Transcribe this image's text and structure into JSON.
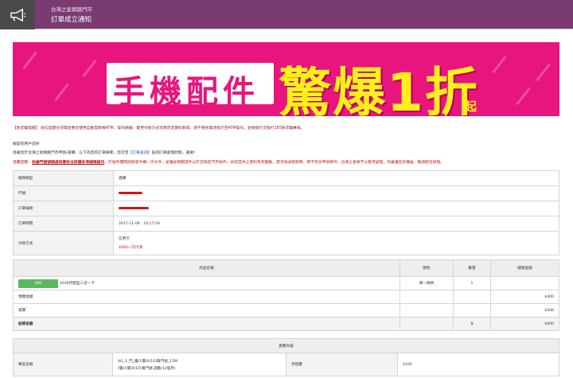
{
  "header": {
    "title": "台灣之星網路門市",
    "subtitle": "訂單成立通知",
    "logo_icon": "megaphone-icon"
  },
  "banner": {
    "prefix": "手機配件",
    "headline": "驚爆1折",
    "suffix": "起"
  },
  "notice": "【防詐騙提醒】 收信提醒任何電話要您使用自動提款機ATM，操作網銀，變更付款方式或更改定期扣款等，請不要依電話指示至ATM操作，並撥撥打可撥打165防詐騙專線。",
  "greeting": "親愛的用戶您好",
  "thanks_prefix": "感謝您於台灣之星網路門市申辦/選購，以下為您的訂單摘要，您可至",
  "thanks_link": "【訂單查詢】",
  "thanks_suffix": "查詢訂單處理狀態，謝謝！",
  "warning_prefix": "溫馨提醒：",
  "warning_bold": "依據門號號碼通訊應依法保護各項號碼操作",
  "warning_rest": "，於送件期間請留意手機一次文件，並攜妥相關證件以於您指定門市收件，依您提供之資料有所變動，需求後收取款時，即不符合申辦要件，台灣之星將予以暫停處理，為維護您的權益，敬請配合辦理。",
  "order": {
    "rows": [
      {
        "key": "服務類型",
        "value": "選購"
      },
      {
        "key": "門號",
        "value": ""
      },
      {
        "key": "訂單編號",
        "value": ""
      },
      {
        "key": "訂單時間",
        "value": "2017-11-09　20:17:54"
      }
    ],
    "payment_key": "付款方式",
    "payment_value": "信用卡",
    "payment_note": "$000一次付清"
  },
  "products": {
    "headers": [
      "商品名稱",
      "顏色",
      "數量",
      "總帳金額"
    ],
    "items": [
      {
        "badge": "SIM",
        "name": "2018月租型三合一卡",
        "color": "單一規格",
        "qty": "1",
        "amount": ""
      }
    ],
    "extras": [
      {
        "label": "預繳金額",
        "amount": "$400"
      },
      {
        "label": "運費",
        "amount": "$200"
      }
    ],
    "total_label": "結帳金額",
    "total_qty": "1",
    "total_amount": "$600"
  },
  "plan": {
    "header": "資費內容",
    "key": "專案名稱",
    "value_line1": "4G_3_門_優(1價)0(10)萬門號_12M",
    "value_line2": "(優(1價)0(10)萬門號,週數/12個月)",
    "fee_key": "月租費",
    "fee_value": "$100"
  }
}
